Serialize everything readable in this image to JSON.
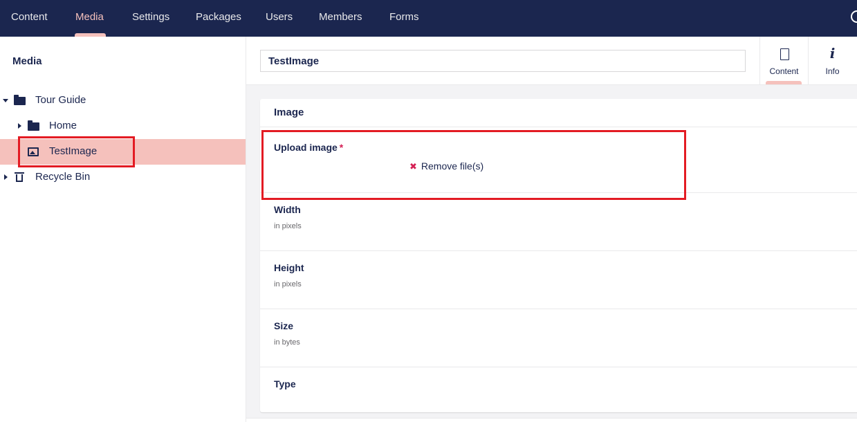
{
  "topnav": {
    "items": [
      {
        "label": "Content",
        "active": false
      },
      {
        "label": "Media",
        "active": true
      },
      {
        "label": "Settings",
        "active": false
      },
      {
        "label": "Packages",
        "active": false
      },
      {
        "label": "Users",
        "active": false
      },
      {
        "label": "Members",
        "active": false
      },
      {
        "label": "Forms",
        "active": false
      }
    ],
    "search_icon": "search-icon"
  },
  "sidebar": {
    "title": "Media",
    "tree": [
      {
        "label": "Tour Guide",
        "icon": "folder-icon",
        "expanded": true
      },
      {
        "label": "Home",
        "icon": "folder-icon",
        "expanded": false
      },
      {
        "label": "TestImage",
        "icon": "image-icon",
        "selected": true
      },
      {
        "label": "Recycle Bin",
        "icon": "trash-icon",
        "expanded": false
      }
    ]
  },
  "editor": {
    "name": "TestImage",
    "apps": [
      {
        "label": "Content",
        "icon": "document-icon",
        "active": true
      },
      {
        "label": "Info",
        "icon": "info-icon",
        "active": false
      }
    ],
    "group_title": "Image",
    "properties": [
      {
        "label": "Upload image",
        "required_mark": "*",
        "action": "Remove file(s)"
      },
      {
        "label": "Width",
        "description": "in pixels"
      },
      {
        "label": "Height",
        "description": "in pixels"
      },
      {
        "label": "Size",
        "description": "in bytes"
      },
      {
        "label": "Type"
      }
    ]
  },
  "colors": {
    "topbar": "#1b264f",
    "active_accent": "#f5c1bc",
    "highlight_box": "#e31b23",
    "required": "#d42054"
  }
}
